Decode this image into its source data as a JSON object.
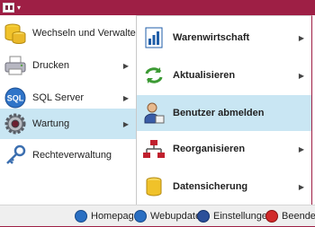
{
  "colors": {
    "accent": "#9e1f45",
    "highlight": "#c9e6f3"
  },
  "app_button": {
    "icon": "app-menu-icon",
    "caret": "▾"
  },
  "left_menu": [
    {
      "label": "Wechseln und Verwalten",
      "icon": "database-icon",
      "submenu": false,
      "active": false
    },
    {
      "label": "Drucken",
      "icon": "printer-icon",
      "submenu": true,
      "active": false
    },
    {
      "label": "SQL Server",
      "icon": "sql-server-icon",
      "submenu": true,
      "active": false
    },
    {
      "label": "Wartung",
      "icon": "gear-icon",
      "submenu": true,
      "active": true
    },
    {
      "label": "Rechteverwaltung",
      "icon": "key-icon",
      "submenu": false,
      "active": false
    }
  ],
  "right_menu": [
    {
      "label": "Warenwirtschaft",
      "icon": "document-chart-icon",
      "submenu": true,
      "active": false
    },
    {
      "label": "Aktualisieren",
      "icon": "refresh-icon",
      "submenu": true,
      "active": false
    },
    {
      "label": "Benutzer abmelden",
      "icon": "user-logout-icon",
      "submenu": false,
      "active": true
    },
    {
      "label": "Reorganisieren",
      "icon": "network-icon",
      "submenu": true,
      "active": false
    },
    {
      "label": "Datensicherung",
      "icon": "database-backup-icon",
      "submenu": true,
      "active": false
    }
  ],
  "submenu_arrow": "▶",
  "status_bar": [
    {
      "label": "Homepage",
      "icon": "globe-icon"
    },
    {
      "label": "Webupdate",
      "icon": "globe-update-icon"
    },
    {
      "label": "Einstellungen",
      "icon": "settings-icon"
    },
    {
      "label": "Beenden",
      "icon": "exit-icon"
    }
  ]
}
